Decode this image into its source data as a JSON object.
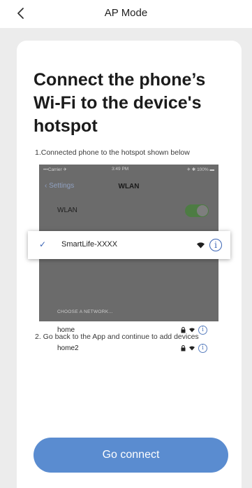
{
  "header": {
    "title": "AP Mode",
    "back_icon": "chevron-left-icon"
  },
  "main": {
    "headline": "Connect the phone’s Wi-Fi to the device's hotspot",
    "step1": "1.Connected phone to the hotspot shown below",
    "step2": "2. Go back to the App and continue to add devices",
    "connect_button": "Go connect"
  },
  "illustration": {
    "status_carrier": "•••Carrier ✈",
    "status_time": "3:49 PM",
    "status_battery": "✈ ✱ 100% ▬",
    "nav_back": "‹ Settings",
    "nav_title": "WLAN",
    "wlan_label": "WLAN",
    "wlan_toggle_on": true,
    "selected_network": "SmartLife-XXXX",
    "section_label": "CHOOSE A NETWORK...",
    "networks": [
      {
        "name": "home"
      },
      {
        "name": "home2"
      }
    ],
    "info_glyph": "i",
    "check_glyph": "✓"
  },
  "colors": {
    "accent": "#5a8cd0",
    "check_blue": "#3a64b5",
    "background": "#ececec",
    "card": "#ffffff"
  }
}
